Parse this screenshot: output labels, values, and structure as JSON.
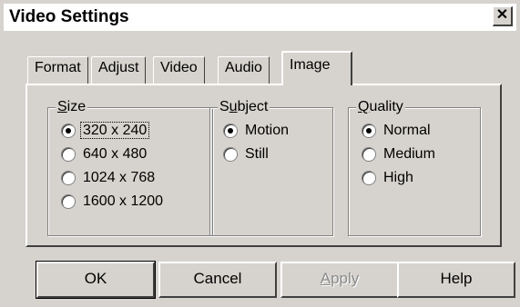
{
  "window": {
    "title": "Video Settings",
    "close_glyph": "✕",
    "close_icon": "close-icon"
  },
  "tabs": [
    {
      "label": "Format"
    },
    {
      "label": "Adjust"
    },
    {
      "label": "Video"
    },
    {
      "label": "Audio"
    },
    {
      "label": "Image",
      "active": true
    }
  ],
  "groups": {
    "size": {
      "label_mnemonic": "S",
      "label_rest": "ize",
      "options": [
        "320 x 240",
        "640 x 480",
        "1024 x 768",
        "1600 x 1200"
      ],
      "selected": "320 x 240"
    },
    "subject": {
      "label_pre": "S",
      "label_mnemonic": "u",
      "label_rest": "bject",
      "options": [
        "Motion",
        "Still"
      ],
      "selected": "Motion"
    },
    "quality": {
      "label_mnemonic": "Q",
      "label_rest": "uality",
      "options": [
        "Normal",
        "Medium",
        "High"
      ],
      "selected": "Normal"
    }
  },
  "buttons": {
    "ok": "OK",
    "cancel": "Cancel",
    "apply": "Apply",
    "apply_mnemonic": "A",
    "apply_rest": "pply",
    "apply_disabled": true,
    "help": "Help"
  },
  "colors": {
    "face": "#d6d3ce",
    "highlight": "#ffffff",
    "shadow": "#404040",
    "disabled_text": "#8a8a8a"
  }
}
